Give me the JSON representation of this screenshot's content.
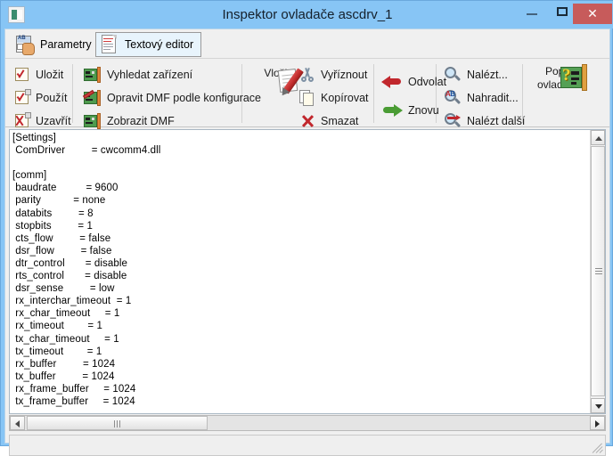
{
  "window": {
    "title": "Inspektor ovladače ascdrv_1",
    "icon": "application-icon",
    "controls": {
      "minimize": "minimize-icon",
      "maximize": "maximize-icon",
      "close": "close-icon"
    },
    "colors": {
      "titlebar": "#87c5f5",
      "close_button": "#c75b5b",
      "toolbar_bg": "#f0f0f0",
      "editor_bg": "#ffffff",
      "tab_selected_bg": "#e8f4fc",
      "accent_red": "#c1272d",
      "accent_green": "#4a9c34"
    }
  },
  "tabs": [
    {
      "id": "parametry",
      "label": "Parametry",
      "icon": "parameters-icon",
      "selected": false
    },
    {
      "id": "textovy-editor",
      "label": "Textový editor",
      "icon": "text-document-icon",
      "selected": true
    }
  ],
  "toolbar": {
    "groups": [
      {
        "id": "file",
        "items": [
          {
            "id": "ulozit",
            "label": "Uložit",
            "icon": "checkbox-check-icon"
          },
          {
            "id": "pouzit",
            "label": "Použít",
            "icon": "checkbox-check-overlay-icon"
          },
          {
            "id": "uzavrit",
            "label": "Uzavřít",
            "icon": "checkbox-x-overlay-icon"
          }
        ]
      },
      {
        "id": "device",
        "items": [
          {
            "id": "vyhledat-zarizeni",
            "label": "Vyhledat zařízení",
            "icon": "device-card-icon"
          },
          {
            "id": "opravit-dmf",
            "label": "Opravit DMF podle konfigurace",
            "icon": "device-card-repair-icon"
          },
          {
            "id": "zobrazit-dmf",
            "label": "Zobrazit DMF",
            "icon": "device-card-icon"
          }
        ]
      },
      {
        "id": "clipboard",
        "big": {
          "id": "vlozit",
          "label": "Vložit",
          "icon": "paste-icon"
        },
        "items": [
          {
            "id": "vyriznout",
            "label": "Vyříznout",
            "icon": "scissors-icon"
          },
          {
            "id": "kopirovat",
            "label": "Kopírovat",
            "icon": "copy-icon"
          },
          {
            "id": "smazat",
            "label": "Smazat",
            "icon": "delete-x-icon"
          }
        ]
      },
      {
        "id": "history",
        "items": [
          {
            "id": "odvolat",
            "label": "Odvolat",
            "icon": "undo-arrow-icon"
          },
          {
            "id": "znovu",
            "label": "Znovu",
            "icon": "redo-arrow-icon"
          }
        ]
      },
      {
        "id": "find",
        "items": [
          {
            "id": "nalezt",
            "label": "Nalézt...",
            "icon": "magnifier-icon"
          },
          {
            "id": "nahradit",
            "label": "Nahradit...",
            "icon": "magnifier-replace-icon"
          },
          {
            "id": "nalezt-dalsi",
            "label": "Nalézt další",
            "icon": "magnifier-next-icon"
          }
        ]
      },
      {
        "id": "help",
        "big": {
          "id": "popis-ovladace",
          "label_line1": "Popis",
          "label_line2": "ovladače",
          "icon": "driver-help-icon"
        }
      }
    ]
  },
  "editor": {
    "content": "[Settings]\n ComDriver         = cwcomm4.dll\n\n[comm]\n baudrate          = 9600\n parity           = none\n databits         = 8\n stopbits         = 1\n cts_flow         = false\n dsr_flow         = false\n dtr_control       = disable\n rts_control       = disable\n dsr_sense         = low\n rx_interchar_timeout  = 1\n rx_char_timeout     = 1\n rx_timeout        = 1\n tx_char_timeout     = 1\n tx_timeout        = 1\n rx_buffer         = 1024\n tx_buffer         = 1024\n rx_frame_buffer     = 1024\n tx_frame_buffer     = 1024",
    "scrollbars": {
      "vertical": "vertical-scrollbar",
      "horizontal": "horizontal-scrollbar"
    }
  },
  "statusbar": {
    "text": ""
  }
}
